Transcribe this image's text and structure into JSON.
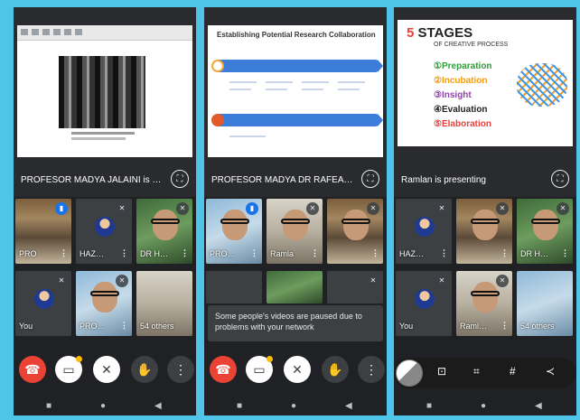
{
  "phones": [
    {
      "presenter_caption": "PROFESOR MADYA JALAINI is present…",
      "tiles": [
        {
          "name": "PRO",
          "kind": "shelf"
        },
        {
          "name": "HAZ…",
          "kind": "avatar"
        },
        {
          "name": "DR H…",
          "kind": "green"
        },
        {
          "name": "You",
          "kind": "avatar"
        },
        {
          "name": "PRO…",
          "kind": "blue"
        },
        {
          "name": "54 others",
          "kind": "office"
        }
      ]
    },
    {
      "presenter_caption": "PROFESOR MADYA DR RAFEAH is pres…",
      "tiles": [
        {
          "name": "PRO…",
          "kind": "blue"
        },
        {
          "name": "Ramla",
          "kind": "office"
        },
        {
          "name": "",
          "kind": "shelf"
        }
      ],
      "toast": "Some people's videos are paused due to problems with your network",
      "slide_title": "Establishing Potential Research Collaboration"
    },
    {
      "presenter_caption": "Ramlan is presenting",
      "tiles": [
        {
          "name": "HAZ…",
          "kind": "avatar"
        },
        {
          "name": "",
          "kind": "shelf"
        },
        {
          "name": "DR H…",
          "kind": "green"
        },
        {
          "name": "You",
          "kind": "avatar"
        },
        {
          "name": "Raml…",
          "kind": "office"
        },
        {
          "name": "54 others",
          "kind": "office"
        }
      ],
      "slide": {
        "title_number": "5",
        "title_word": "STAGES",
        "subtitle": "OF CREATIVE PROCESS",
        "stages": [
          {
            "label": "①Preparation",
            "color": "#2e9d3a"
          },
          {
            "label": "②Incubation",
            "color": "#f39c12"
          },
          {
            "label": "③Insight",
            "color": "#8e44ad"
          },
          {
            "label": "④Evaluation",
            "color": "#222222"
          },
          {
            "label": "⑤Elaboration",
            "color": "#e8413c"
          }
        ]
      }
    }
  ]
}
